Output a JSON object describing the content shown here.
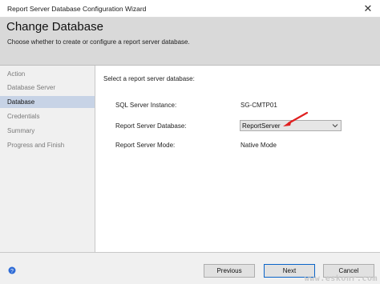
{
  "window": {
    "title": "Report Server Database Configuration Wizard",
    "close_glyph": "✕"
  },
  "header": {
    "title": "Change Database",
    "subtitle": "Choose whether to create or configure a report server database."
  },
  "sidebar": {
    "items": [
      {
        "label": "Action",
        "active": false
      },
      {
        "label": "Database Server",
        "active": false
      },
      {
        "label": "Database",
        "active": true
      },
      {
        "label": "Credentials",
        "active": false
      },
      {
        "label": "Summary",
        "active": false
      },
      {
        "label": "Progress and Finish",
        "active": false
      }
    ]
  },
  "main": {
    "prompt": "Select a report server database:",
    "fields": {
      "instance": {
        "label": "SQL Server Instance:",
        "value": "SG-CMTP01"
      },
      "database": {
        "label": "Report Server Database:",
        "value": "ReportServer"
      },
      "mode": {
        "label": "Report Server Mode:",
        "value": "Native Mode"
      }
    }
  },
  "buttons": {
    "previous": "Previous",
    "next": "Next",
    "cancel": "Cancel"
  },
  "watermark": "www.eskonr.com",
  "icons": {
    "help": "help-icon",
    "close": "close-icon",
    "dropdown": "chevron-down-icon",
    "annotation": "red-arrow-icon"
  },
  "colors": {
    "header_bg": "#d9d9d9",
    "sidebar_bg": "#f0f0f0",
    "active_item_bg": "#c7d3e6",
    "annotation_arrow": "#e02020",
    "help_icon": "#2e6bd6"
  }
}
